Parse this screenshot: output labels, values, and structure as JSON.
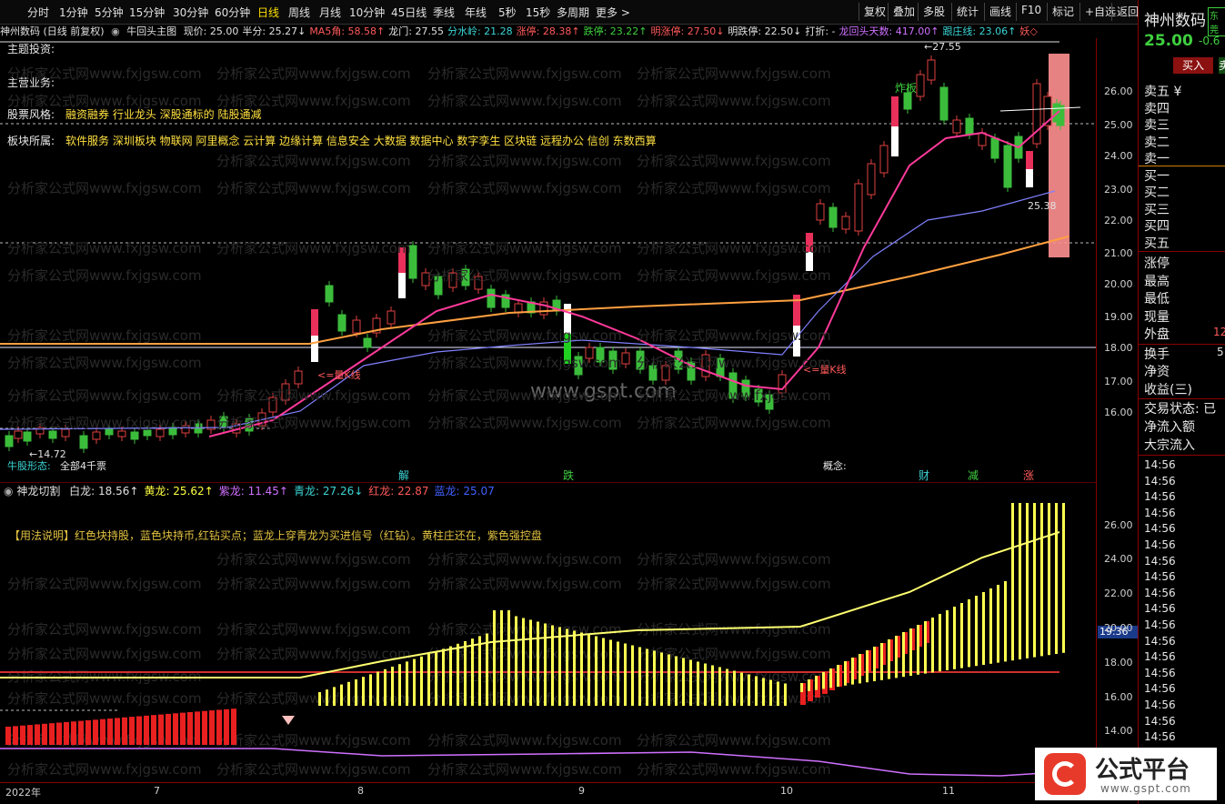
{
  "toolbar": {
    "periods": [
      "分时",
      "1分钟",
      "5分钟",
      "15分钟",
      "30分钟",
      "60分钟",
      "日线",
      "周线",
      "月线",
      "10分钟",
      "45日线",
      "季线",
      "年线",
      "5秒",
      "15秒",
      "多周期",
      "更多 >"
    ],
    "active_period": "日线",
    "right_buttons": [
      "复权",
      "叠加",
      "多股",
      "统计",
      "画线",
      "F10",
      "标记",
      "+自选",
      "返回"
    ]
  },
  "info_bar": {
    "stock": "神州数码 (日线 前复权)",
    "indicator": "牛回头主图",
    "items": [
      {
        "label": "现价: 25.00",
        "color": "#e0e0e0"
      },
      {
        "label": "半分: 25.27↓",
        "color": "#e0e0e0"
      },
      {
        "label": "MA5角: 58.58↑",
        "color": "#ff5a5a"
      },
      {
        "label": "龙门: 27.55",
        "color": "#e0e0e0"
      },
      {
        "label": "分水岭: 21.28",
        "color": "#3bd5d5"
      },
      {
        "label": "涨停: 28.38↑",
        "color": "#ff5a5a"
      },
      {
        "label": "跌停: 23.22↑",
        "color": "#3fd03f"
      },
      {
        "label": "明涨停: 27.50↓",
        "color": "#ff5a5a"
      },
      {
        "label": "明跌停: 22.50↓",
        "color": "#e0e0e0"
      },
      {
        "label": "打折: -",
        "color": "#e0e0e0"
      },
      {
        "label": "龙回头天数: 417.00↑",
        "color": "#d070ff"
      },
      {
        "label": "跟庄线: 23.06↑",
        "color": "#3bd5d5"
      },
      {
        "label": "妖◇",
        "color": "#ff5a5a"
      }
    ]
  },
  "overlay_text": {
    "theme_label": "主题投资:",
    "business_label": "主营业务:",
    "style_label": "股票风格:",
    "style_value": "融资融券 行业龙头 深股通标的 陆股通减",
    "sector_label": "板块所属:",
    "sector_value": "软件服务 深圳板块 物联网 阿里概念 云计算 边缘计算 信息安全 大数据 数据中心 数字孪生 区块链 远程办公 信创 东数西算",
    "peak_label": "←27.55",
    "low_label": "←14.72",
    "right_val": "25.38",
    "fire_label": "炸板",
    "k_line_1": "<=量K线",
    "k_line_2": "<=量K线",
    "pattern_label": "牛股形态:",
    "pattern_value": "全部4千票",
    "concept_label": "概念:",
    "markers": [
      {
        "text": "解",
        "color": "#3bd5d5"
      },
      {
        "text": "跌",
        "color": "#3fd03f"
      },
      {
        "text": "财",
        "color": "#3bd5d5"
      },
      {
        "text": "减",
        "color": "#3fd03f"
      },
      {
        "text": "涨",
        "color": "#ff5a5a"
      }
    ],
    "site_url": "www.gspt.com",
    "watermark": "分析家公式网www.fxjgsw.com"
  },
  "sub_panel": {
    "title": "神龙切割",
    "items": [
      {
        "label": "白龙: 18.56↑",
        "color": "#e0e0e0"
      },
      {
        "label": "黄龙: 25.62↑",
        "color": "#ffff40"
      },
      {
        "label": "紫龙: 11.45↑",
        "color": "#d070ff"
      },
      {
        "label": "青龙: 27.26↓",
        "color": "#3bd5d5"
      },
      {
        "label": "红龙: 22.87",
        "color": "#ff5a5a"
      },
      {
        "label": "蓝龙: 25.07",
        "color": "#4060ff"
      }
    ],
    "usage": "【用法说明】红色块持股，蓝色块持币,红钻买点；蓝龙上穿青龙为买进信号（红钻）。黄柱庄还在，紫色强控盘",
    "cursor_val": "19.36"
  },
  "axes": {
    "main_ticks": [
      "26.00",
      "25.00",
      "24.00",
      "23.00",
      "22.00",
      "21.00",
      "20.00",
      "19.00",
      "18.00",
      "17.00",
      "16.00"
    ],
    "sub_ticks": [
      "26.00",
      "24.00",
      "22.00",
      "20.00",
      "18.00",
      "16.00",
      "14.00"
    ],
    "dates": [
      "2022年",
      "7",
      "8",
      "9",
      "10",
      "11"
    ]
  },
  "side": {
    "name": "神州数码",
    "code_tag": "东莞",
    "price": "25.00",
    "change": "-0.6",
    "buy_button": "买入",
    "sell_btn": "卖",
    "sell_rows": [
      "卖五 ¥",
      "卖四",
      "卖三",
      "卖二",
      "卖一"
    ],
    "buy_rows": [
      "买一",
      "买二",
      "买三",
      "买四",
      "买五"
    ],
    "stats": [
      "涨停",
      "最高",
      "最低",
      "现量",
      "外盘"
    ],
    "outer_val": "12",
    "stats2": [
      "换手",
      "净资",
      "收益(三)"
    ],
    "turnover_val": "5",
    "trade_state": "交易状态: 已",
    "flows": [
      "净流入额",
      "大宗流入"
    ],
    "times": [
      "14:56",
      "14:56",
      "14:56",
      "14:56",
      "14:56",
      "14:56",
      "14:56",
      "14:56",
      "14:56",
      "14:56",
      "14:56",
      "14:56",
      "14:56",
      "14:56",
      "14:56",
      "14:56",
      "14:56",
      "14:56"
    ],
    "logo_text": "公式平台",
    "logo_url": "www.gspt.com"
  }
}
